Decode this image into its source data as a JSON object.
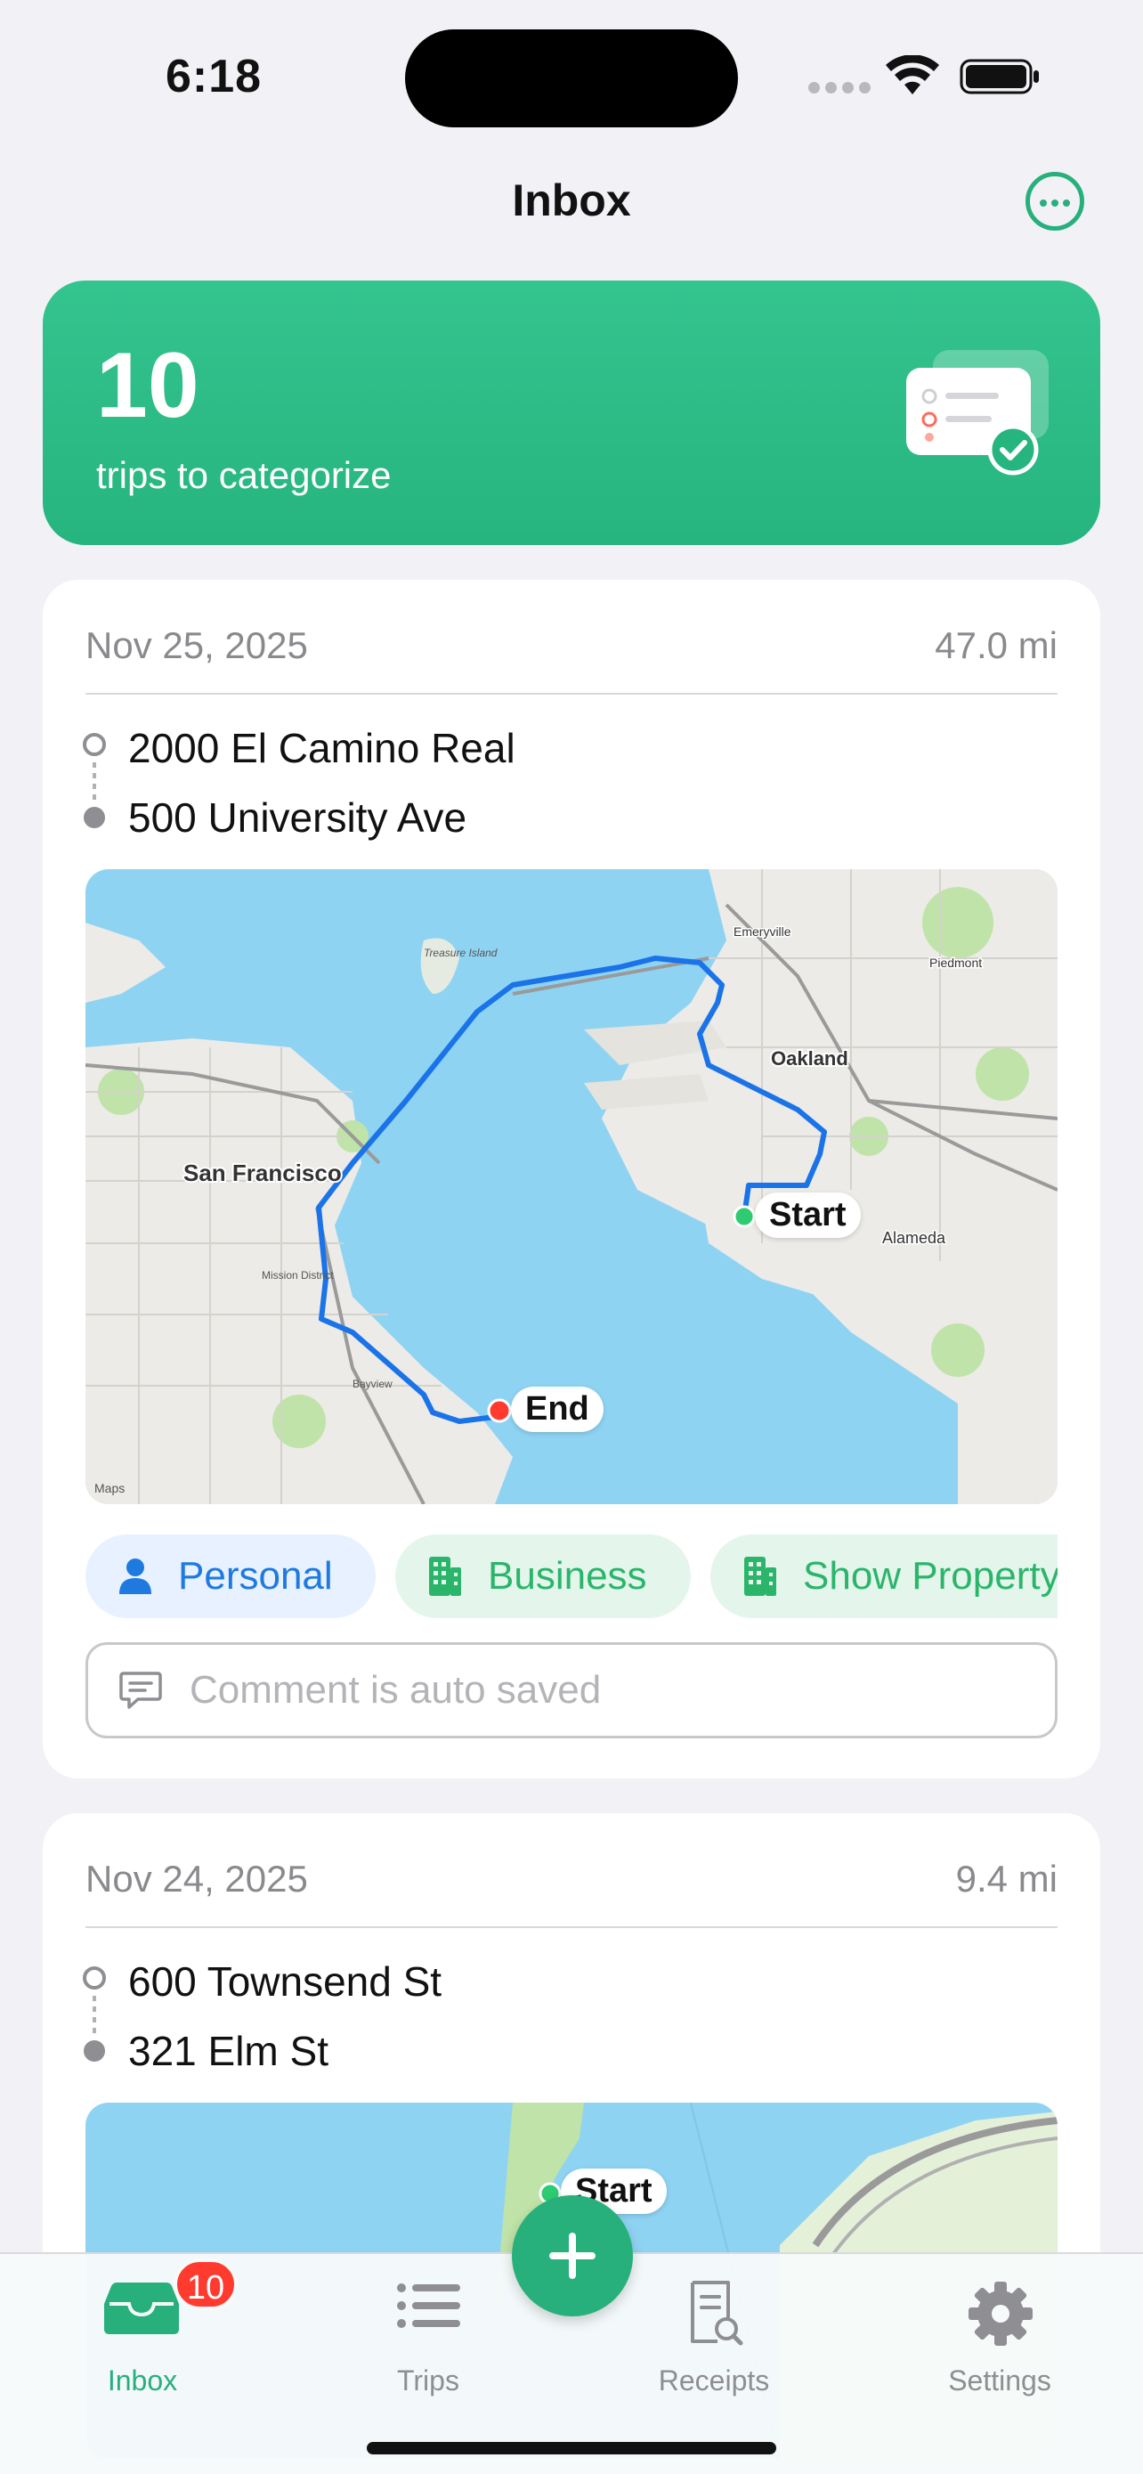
{
  "status_bar": {
    "time": "6:18"
  },
  "nav": {
    "title": "Inbox"
  },
  "hero": {
    "count": "10",
    "label": "trips to categorize"
  },
  "trips": [
    {
      "date": "Nov 25, 2025",
      "distance": "47.0 mi",
      "from": "2000 El Camino Real",
      "to": "500 University Ave",
      "map": {
        "start_label": "Start",
        "end_label": "End",
        "place_labels": [
          "San Francisco",
          "Oakland",
          "Alameda",
          "Emeryville",
          "Piedmont",
          "Treasure Island",
          "Mission District",
          "Bayview"
        ],
        "attribution": "Maps"
      }
    },
    {
      "date": "Nov 24, 2025",
      "distance": "9.4 mi",
      "from": "600 Townsend St",
      "to": "321 Elm St",
      "map": {
        "start_label": "Start"
      }
    }
  ],
  "categories": {
    "personal": "Personal",
    "business": "Business",
    "property": "Show Property"
  },
  "comment": {
    "placeholder": "Comment is auto saved"
  },
  "tabs": {
    "inbox": "Inbox",
    "trips": "Trips",
    "receipts": "Receipts",
    "settings": "Settings",
    "inbox_badge": "10"
  },
  "colors": {
    "accent": "#27b07c",
    "personal": "#1f7ae0",
    "business": "#2bb56b",
    "route": "#1a73e8",
    "start_pin": "#2ecc71",
    "end_pin": "#ff3b30",
    "badge": "#ff3b30"
  }
}
